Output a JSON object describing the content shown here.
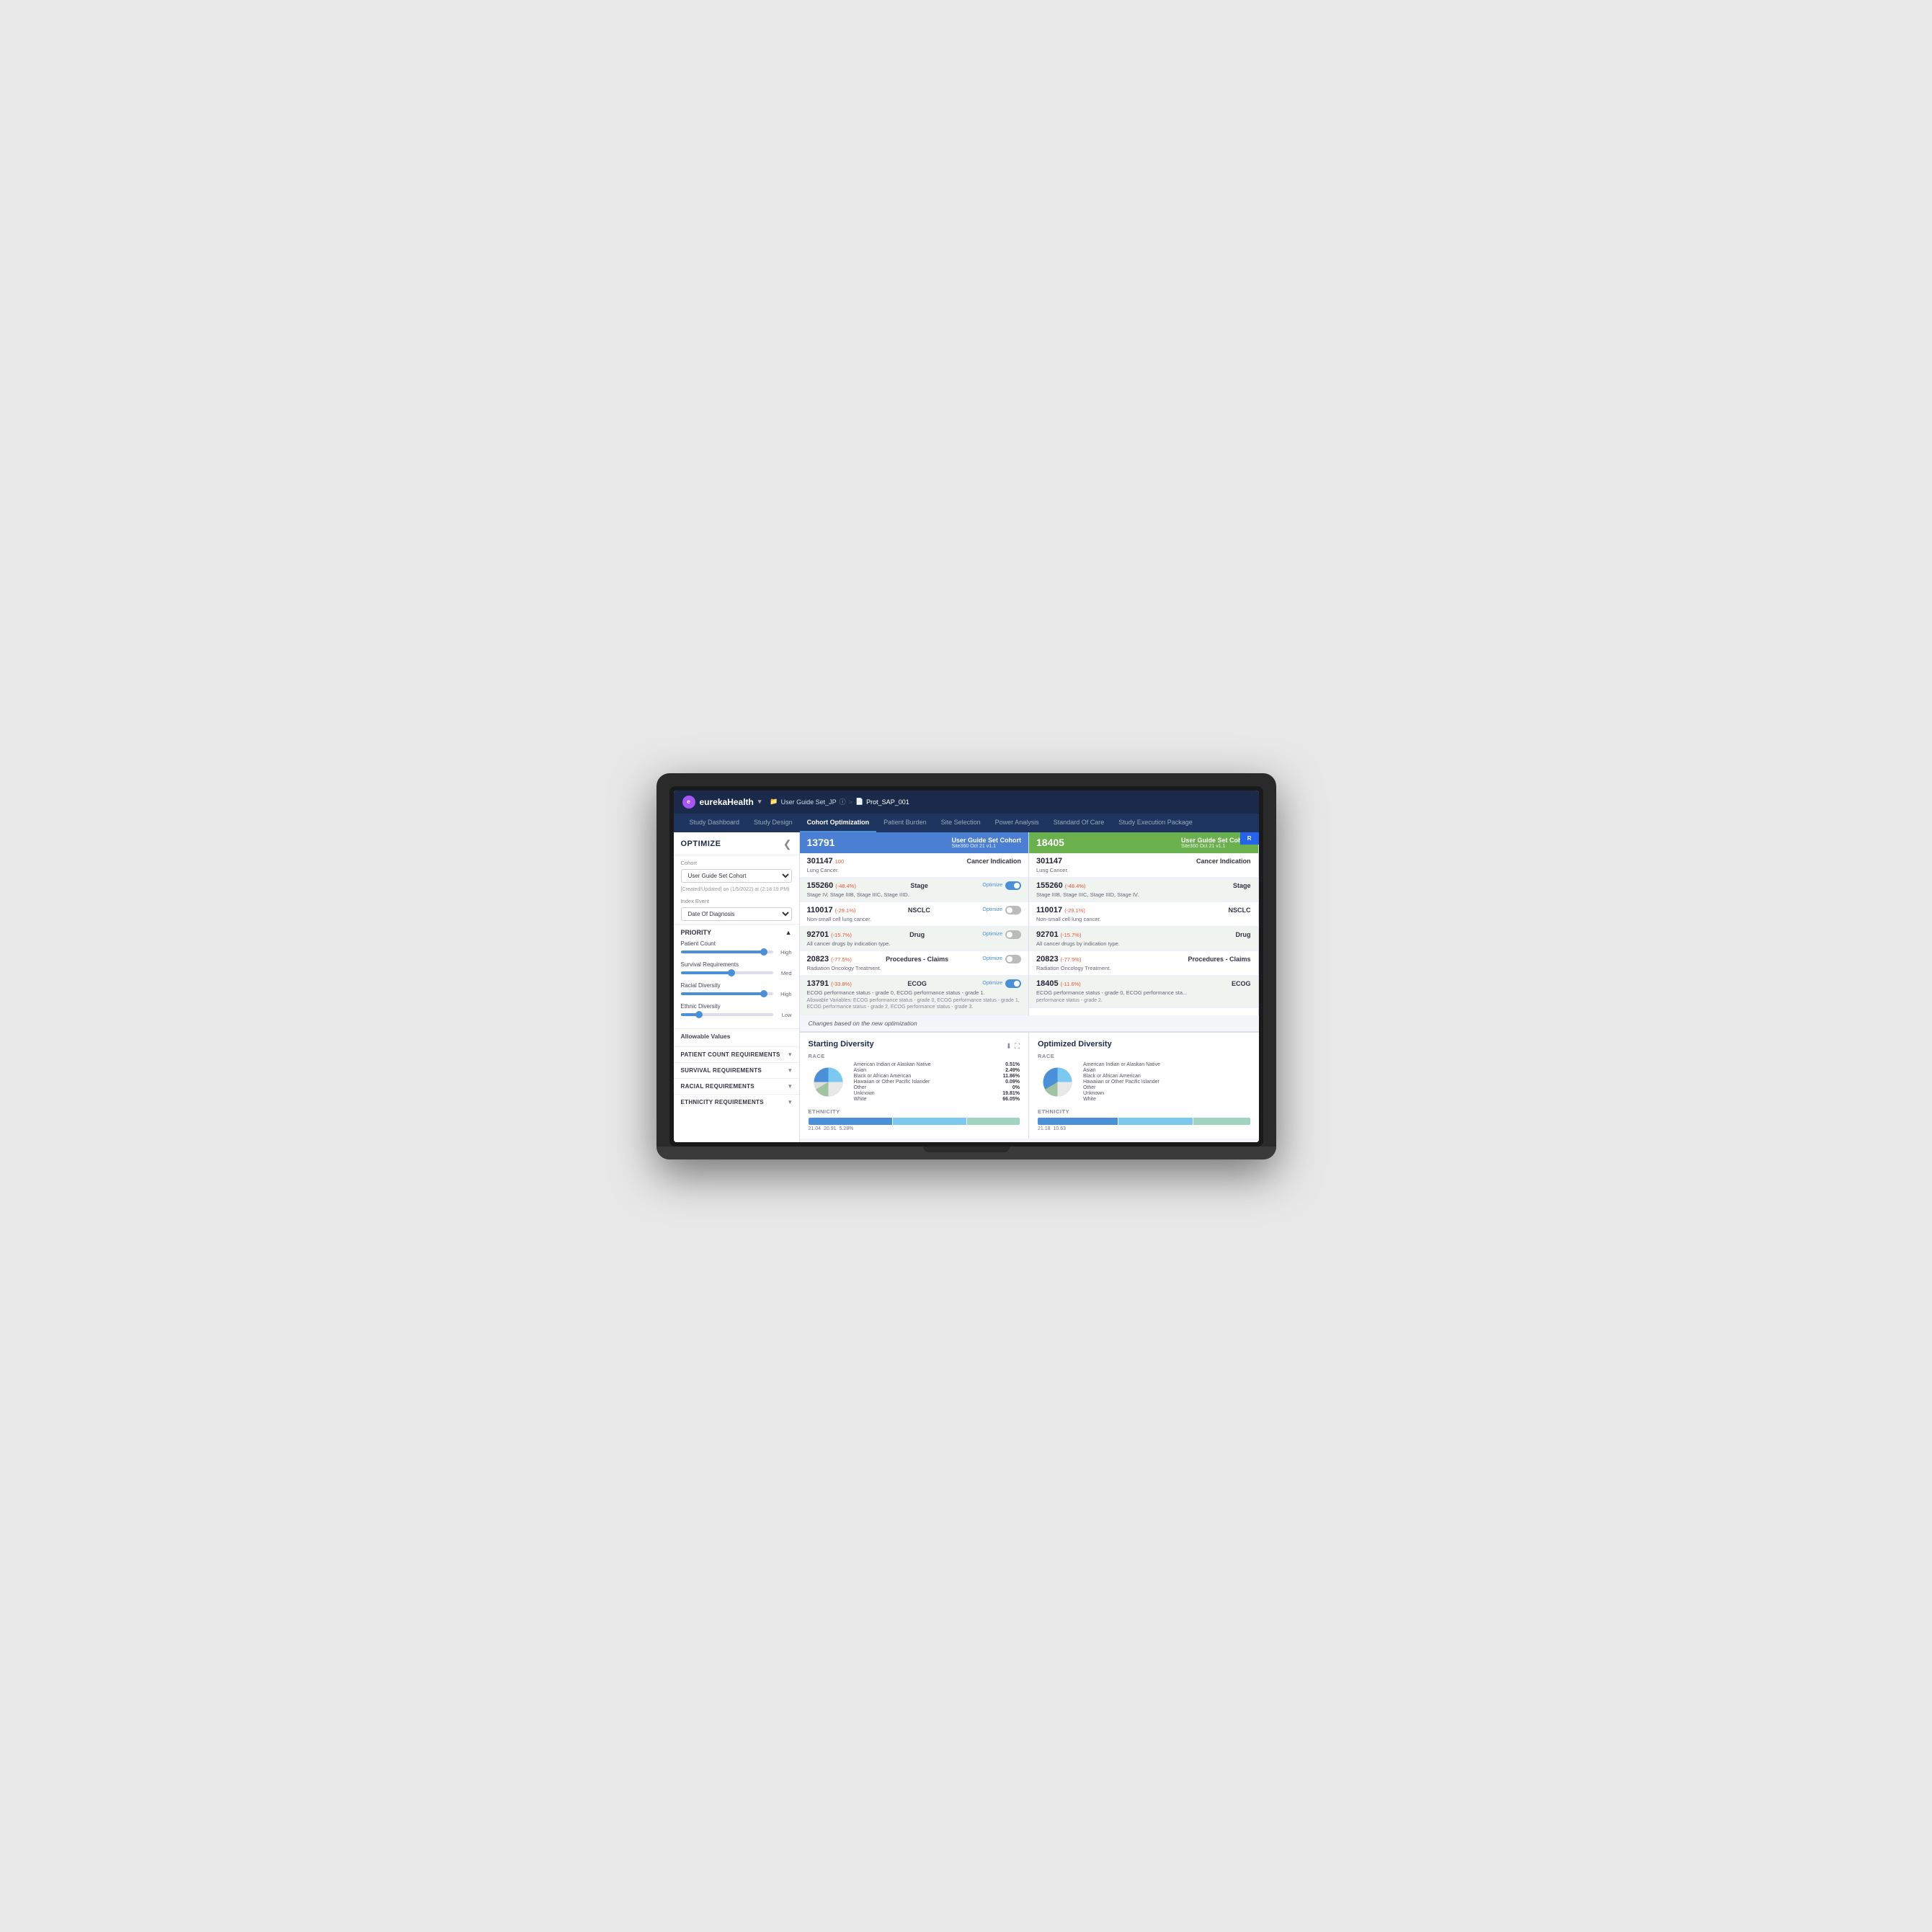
{
  "app": {
    "logo_text": "eurekaHealth",
    "header": {
      "breadcrumb_folder": "User Guide Set_JP",
      "breadcrumb_sep": ">",
      "file_icon": "📄",
      "file_name": "Prot_SAP_001"
    },
    "nav_tabs": [
      {
        "label": "Study Dashboard",
        "active": false
      },
      {
        "label": "Study Design",
        "active": false
      },
      {
        "label": "Cohort Optimization",
        "active": true
      },
      {
        "label": "Patient Burden",
        "active": false
      },
      {
        "label": "Site Selection",
        "active": false
      },
      {
        "label": "Power Analysis",
        "active": false
      },
      {
        "label": "Standard Of Care",
        "active": false
      },
      {
        "label": "Study Execution Package",
        "active": false
      }
    ]
  },
  "sidebar": {
    "title": "OPTIMIZE",
    "cohort_label": "Cohort",
    "cohort_value": "User Guide Set Cohort",
    "meta_text": "[Created/Updated] on (1/5/2022) at (2:18:19 PM)",
    "index_event_label": "Index Event",
    "index_event_value": "Date Of Diagnosis",
    "priority_label": "PRIORITY",
    "priority_items": [
      {
        "label": "Patient Count",
        "value": "High",
        "fill_pct": 90
      },
      {
        "label": "Survival Requirements",
        "value": "Med",
        "fill_pct": 55
      },
      {
        "label": "Racial Diversity",
        "value": "High",
        "fill_pct": 90
      },
      {
        "label": "Ethnic Diversity",
        "value": "Low",
        "fill_pct": 20
      }
    ],
    "allowable_label": "Allowable Values",
    "collapsible_sections": [
      {
        "label": "PATIENT COUNT REQUIREMENTS",
        "open": false
      },
      {
        "label": "SURVIVAL REQUIREMENTS",
        "open": false
      },
      {
        "label": "RACIAL REQUIREMENTS",
        "open": false
      },
      {
        "label": "ETHNICITY REQUIREMENTS",
        "open": false
      }
    ]
  },
  "left_cohort": {
    "id": "13791",
    "name": "User Guide Set Cohort",
    "sub": "Site360 Oct 21 v1.1",
    "criteria": [
      {
        "count": "301147",
        "delta": "100",
        "name": "Cancer Indication",
        "desc": "Lung Cancer.",
        "has_optimize": false,
        "shaded": false
      },
      {
        "count": "155260",
        "delta": "(-48.4%)",
        "name": "Stage",
        "desc": "Stage IV, Stage IIIB, Stage IIIC, Stage IIID.",
        "has_optimize": true,
        "toggle_on": true,
        "shaded": true
      },
      {
        "count": "110017",
        "delta": "(-29.1%)",
        "name": "NSCLC",
        "desc": "Non-small cell lung cancer.",
        "has_optimize": true,
        "toggle_on": false,
        "shaded": false
      },
      {
        "count": "92701",
        "delta": "(-15.7%)",
        "name": "Drug",
        "desc": "All cancer drugs by indication type.",
        "has_optimize": true,
        "toggle_on": false,
        "shaded": true
      },
      {
        "count": "20823",
        "delta": "(-77.5%)",
        "name": "Procedures - Claims",
        "desc": "Radiation Oncology Treatment.",
        "has_optimize": true,
        "toggle_on": false,
        "shaded": false
      },
      {
        "count": "13791",
        "delta": "(-33.8%)",
        "name": "ECOG",
        "desc": "ECOG performance status - grade 0, ECOG performance status - grade 1.",
        "detail": "Allowable Variables: ECOG performance status - grade 0, ECOG performance status - grade 1, ECOG performance status - grade 2, ECOG performance status - grade 3.",
        "has_optimize": true,
        "toggle_on": true,
        "shaded": true
      }
    ]
  },
  "right_cohort": {
    "id": "18405",
    "name": "User Guide Set Cohort",
    "sub": "Site360 Oct 21 v1.1",
    "criteria": [
      {
        "count": "301147",
        "delta": "100",
        "name": "Cancer Indication",
        "desc": "Lung Cancer.",
        "shaded": false
      },
      {
        "count": "155260",
        "delta": "(-48.4%)",
        "name": "Stage",
        "desc": "Stage IIIB, Stage IIIC, Stage IIID, Stage IV.",
        "shaded": true
      },
      {
        "count": "110017",
        "delta": "(-29.1%)",
        "name": "NSCLC",
        "desc": "Non-small cell lung cancer.",
        "shaded": false
      },
      {
        "count": "92701",
        "delta": "(-15.7%)",
        "name": "Drug",
        "desc": "All cancer drugs by indication type.",
        "shaded": true
      },
      {
        "count": "20823",
        "delta": "(-77.5%)",
        "name": "Procedures - Claims",
        "desc": "Radiation Oncology Treatment.",
        "shaded": false
      },
      {
        "count": "18405",
        "delta": "(-11.6%)",
        "name": "ECOG",
        "desc": "ECOG performance status - grade 0, ECOG performance sta...",
        "detail": "performance status - grade 2.",
        "shaded": true
      }
    ]
  },
  "changes_banner": "Changes based on the new optimization",
  "apply_btn": "R",
  "left_diversity": {
    "title": "Starting Diversity",
    "race_label": "RACE",
    "race_items": [
      {
        "name": "American Indian or Alaskan Native",
        "pct": "0.51%"
      },
      {
        "name": "Asian",
        "pct": "2.49%"
      },
      {
        "name": "Black or African American",
        "pct": "11.86%"
      },
      {
        "name": "Hawaiian or Other Pacific Islander",
        "pct": "0.09%"
      },
      {
        "name": "Other",
        "pct": "0%"
      },
      {
        "name": "Unknown",
        "pct": "19.81%"
      },
      {
        "name": "White",
        "pct": "66.05%"
      }
    ],
    "ethnicity_label": "ETHNICITY",
    "eth_segments": [
      {
        "color": "#4a90d9",
        "width_pct": 40,
        "label": "21.04"
      },
      {
        "color": "#7bc8f0",
        "width_pct": 35,
        "label": "20.91"
      },
      {
        "color": "#a0d4a0",
        "width_pct": 25,
        "label": "5.28%"
      }
    ]
  },
  "right_diversity": {
    "title": "Optimized Diversity",
    "race_label": "RACE",
    "race_items": [
      {
        "name": "American Indian or Alaskan Native",
        "pct": ""
      },
      {
        "name": "Asian",
        "pct": ""
      },
      {
        "name": "Black or African American",
        "pct": ""
      },
      {
        "name": "Hawaiian or Other Pacific Islander",
        "pct": ""
      },
      {
        "name": "Other",
        "pct": ""
      },
      {
        "name": "Unknown",
        "pct": ""
      },
      {
        "name": "White",
        "pct": ""
      }
    ],
    "ethnicity_label": "ETHNICITY",
    "eth_segments": [
      {
        "color": "#4a90d9",
        "width_pct": 38,
        "label": "21.18"
      },
      {
        "color": "#7bc8f0",
        "width_pct": 35,
        "label": "10.63"
      },
      {
        "color": "#a0d4a0",
        "width_pct": 27,
        "label": ""
      }
    ]
  }
}
